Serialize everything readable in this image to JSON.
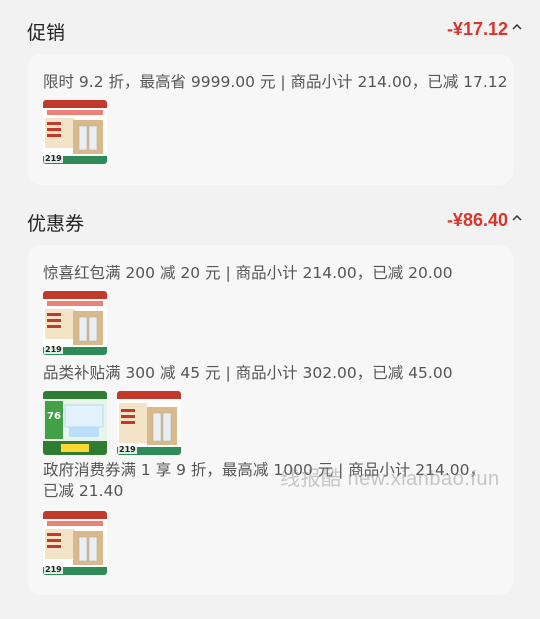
{
  "promo": {
    "title": "促销",
    "amount": "-¥17.12",
    "line": "限时 9.2 折，最高省 9999.00 元 | 商品小计 214.00，已减 17.12",
    "thumb_price": "219"
  },
  "coupon": {
    "title": "优惠券",
    "amount": "-¥86.40",
    "items": [
      {
        "text": "惊喜红包满 200 减 20 元 | 商品小计 214.00，已减 20.00",
        "thumb_prices": [
          "219"
        ]
      },
      {
        "text": "品类补贴满 300 减 45 元 | 商品小计 302.00，已减 45.00",
        "thumb_prices": [
          "",
          "219"
        ],
        "green_badge": "76"
      },
      {
        "text": "政府消费券满 1 享 9 折，最高减 1000 元 | 商品小计 214.00，已减 21.40",
        "thumb_prices": [
          "219"
        ]
      }
    ]
  },
  "watermark": "线报酷 new.xianbao.fun",
  "colors": {
    "accent": "#d8352c",
    "background": "#f2f2f2",
    "card": "#f7f7f7"
  },
  "icons": {
    "collapse": "chevron-up-icon"
  }
}
